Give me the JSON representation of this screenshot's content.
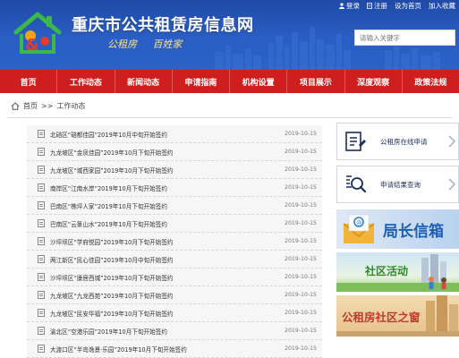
{
  "top_links": {
    "login": "登录",
    "register": "注册",
    "homepage": "设为首页",
    "favorite": "加入收藏"
  },
  "site": {
    "title": "重庆市公共租赁房信息网",
    "slogan": "公租房 百姓家"
  },
  "search": {
    "placeholder": "请输入关键字"
  },
  "nav": [
    "首页",
    "工作动态",
    "新闻动态",
    "申请指南",
    "机构设置",
    "项目展示",
    "深度观察",
    "政策法规"
  ],
  "breadcrumb": {
    "home": "首页",
    "separator": ">>",
    "current": "工作动态"
  },
  "news": [
    {
      "title": "北碚区“碚都佳园”2019年10月中旬开始签约",
      "date": "2019-10-15"
    },
    {
      "title": "九龙坡区“金凤佳园”2019年10月下旬开始签约",
      "date": "2019-10-15"
    },
    {
      "title": "九龙坡区“城西家园”2019年10月下旬开始签约",
      "date": "2019-10-15"
    },
    {
      "title": "南岸区“江南水岸”2019年10月下旬开始签约",
      "date": "2019-10-15"
    },
    {
      "title": "巴南区“樵坪人家”2019年10月下旬开始签约",
      "date": "2019-10-15"
    },
    {
      "title": "巴南区“云篆山水”2019年10月下旬开始签约",
      "date": "2019-10-15"
    },
    {
      "title": "沙坪坝区“学府悦园”2019年10月下旬开始签约",
      "date": "2019-10-15"
    },
    {
      "title": "两江新区“民心佳园”2019年10月中旬开始签约",
      "date": "2019-10-15"
    },
    {
      "title": "沙坪坝区“康居西城”2019年10月下旬开始签约",
      "date": "2019-10-15"
    },
    {
      "title": "九龙坡区“九龙西苑”2019年10月下旬开始签约",
      "date": "2019-10-15"
    },
    {
      "title": "九龙坡区“民安华福”2019年10月下旬开始签约",
      "date": "2019-10-15"
    },
    {
      "title": "渝北区“空港乐园”2019年10月下旬开始签约",
      "date": "2019-10-15"
    },
    {
      "title": "大渡口区“半岛逸景·乐园”2019年10月下旬开始签约",
      "date": "2019-10-15"
    }
  ],
  "sidebar": {
    "apply_online": "公租房在线申请",
    "result_query": "申请结果查询",
    "director_mailbox": "局长信箱",
    "community_activity": "社区活动",
    "community_window": "公租房社区之窗"
  },
  "colors": {
    "header_blue": "#2a5ec4",
    "nav_red": "#cf1e1e",
    "slogan_gold": "#ffe27a",
    "card_navy": "#1a2c5a"
  }
}
